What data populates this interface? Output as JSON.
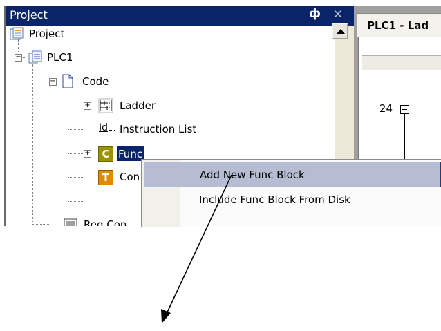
{
  "panel": {
    "title": "Project",
    "pin_glyph": "ф",
    "close_glyph": "×"
  },
  "tree": {
    "items": [
      {
        "label": "Project",
        "icon": "project-icon"
      },
      {
        "label": "PLC1",
        "icon": "plc-icon",
        "expander": "−"
      },
      {
        "label": "Code",
        "icon": "page-icon",
        "expander": "−"
      },
      {
        "label": "Ladder",
        "icon": "ladder-icon",
        "expander": "+"
      },
      {
        "label": "Instruction List",
        "icon": "instruction-list-icon",
        "icon_text": "Id"
      },
      {
        "label": "Func",
        "icon": "func-block-icon",
        "icon_text": "C",
        "expander": "+"
      },
      {
        "label": "Con",
        "icon": "text-icon",
        "icon_text": "T"
      },
      {
        "label": "Reg Con",
        "icon": "register-icon"
      }
    ]
  },
  "document": {
    "tab_label": "PLC1 - Lad",
    "rung_number": "24"
  },
  "context_menu": {
    "items": [
      {
        "label": "Add New Func Block",
        "highlighted": true
      },
      {
        "label": "Include Func Block From Disk",
        "highlighted": false
      }
    ]
  },
  "colors": {
    "header_bg": "#0a246a",
    "menu_highlight": "#b6bdd2",
    "func_icon": "#9a9400",
    "text_icon": "#e08a00"
  }
}
